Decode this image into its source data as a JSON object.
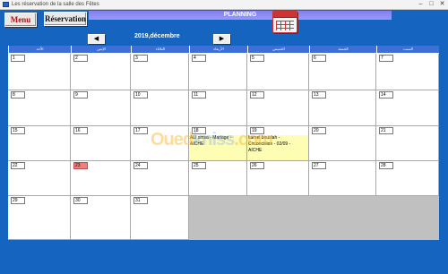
{
  "window": {
    "title": "Les réservation de la salle des Fêtes"
  },
  "toolbar": {
    "menu_label": "Menu",
    "reservation_label": "Réservation"
  },
  "header": {
    "planning_label": "PLANNING",
    "month_label": "2019,décembre",
    "prev_icon": "arrow-left-icon",
    "next_icon": "arrow-right-icon"
  },
  "weekdays": [
    "الأحد",
    "الإثنين",
    "الثلاثاء",
    "الأربعاء",
    "الخميس",
    "الجمعة",
    "السبت"
  ],
  "days": [
    {
      "n": "1"
    },
    {
      "n": "2"
    },
    {
      "n": "3"
    },
    {
      "n": "4"
    },
    {
      "n": "5"
    },
    {
      "n": "6"
    },
    {
      "n": "7"
    },
    {
      "n": "8"
    },
    {
      "n": "9"
    },
    {
      "n": "10"
    },
    {
      "n": "11"
    },
    {
      "n": "12"
    },
    {
      "n": "13"
    },
    {
      "n": "14"
    },
    {
      "n": "15"
    },
    {
      "n": "16"
    },
    {
      "n": "17"
    },
    {
      "n": "18"
    },
    {
      "n": "19"
    },
    {
      "n": "20"
    },
    {
      "n": "21"
    },
    {
      "n": "22"
    },
    {
      "n": "23",
      "today": true
    },
    {
      "n": "24"
    },
    {
      "n": "25"
    },
    {
      "n": "26"
    },
    {
      "n": "27"
    },
    {
      "n": "28"
    },
    {
      "n": "29"
    },
    {
      "n": "30"
    },
    {
      "n": "31"
    }
  ],
  "events": [
    {
      "text": "ALI smsa - Mariage -\nAICHE"
    },
    {
      "text": "kamel bouslah -\nCirconcision - 02/09 -\nAICHE"
    }
  ],
  "watermark": {
    "part1": "Oued",
    "part2": "kniss",
    "part3": ".com"
  },
  "colors": {
    "background": "#1565c0",
    "planning_bar": "#8a8af4",
    "event_highlight": "#fdfdb4",
    "today": "#f08080"
  }
}
